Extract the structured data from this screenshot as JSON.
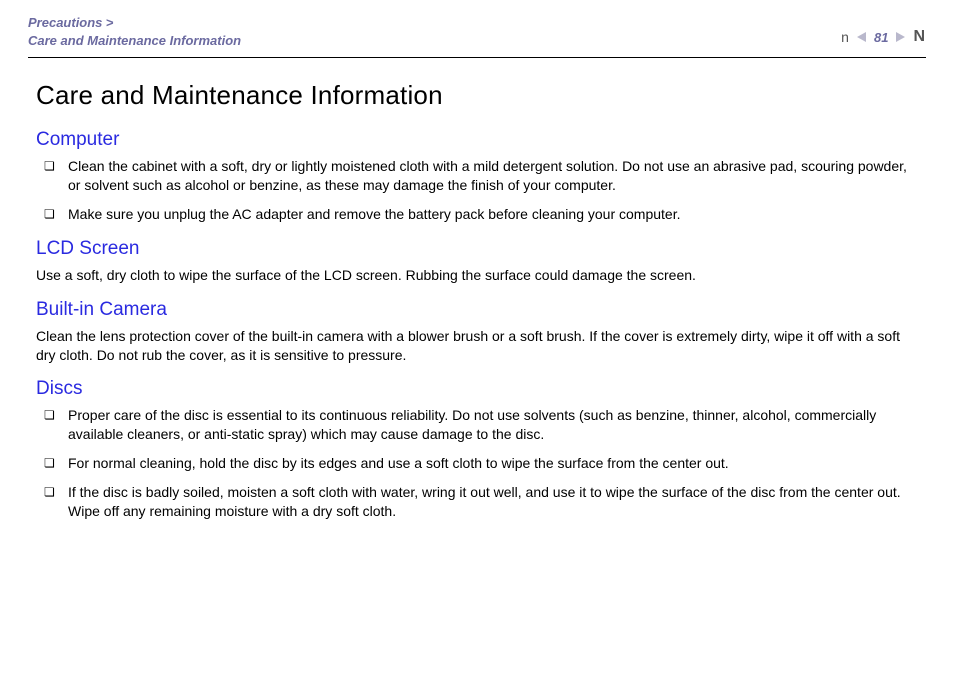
{
  "header": {
    "breadcrumb_parent": "Precautions",
    "breadcrumb_sep": ">",
    "breadcrumb_current": "Care and Maintenance Information",
    "n_letter": "n",
    "page_number": "81",
    "big_N": "N"
  },
  "title": "Care and Maintenance Information",
  "sections": {
    "computer": {
      "heading": "Computer",
      "items": [
        "Clean the cabinet with a soft, dry or lightly moistened cloth with a mild detergent solution. Do not use an abrasive pad, scouring powder, or solvent such as alcohol or benzine, as these may damage the finish of your computer.",
        "Make sure you unplug the AC adapter and remove the battery pack before cleaning your computer."
      ]
    },
    "lcd": {
      "heading": "LCD Screen",
      "text": "Use a soft, dry cloth to wipe the surface of the LCD screen. Rubbing the surface could damage the screen."
    },
    "camera": {
      "heading": "Built-in Camera",
      "text": "Clean the lens protection cover of the built-in camera with a blower brush or a soft brush. If the cover is extremely dirty, wipe it off with a soft dry cloth. Do not rub the cover, as it is sensitive to pressure."
    },
    "discs": {
      "heading": "Discs",
      "items": [
        "Proper care of the disc is essential to its continuous reliability. Do not use solvents (such as benzine, thinner, alcohol, commercially available cleaners, or anti-static spray) which may cause damage to the disc.",
        "For normal cleaning, hold the disc by its edges and use a soft cloth to wipe the surface from the center out.",
        "If the disc is badly soiled, moisten a soft cloth with water, wring it out well, and use it to wipe the surface of the disc from the center out. Wipe off any remaining moisture with a dry soft cloth."
      ]
    }
  }
}
